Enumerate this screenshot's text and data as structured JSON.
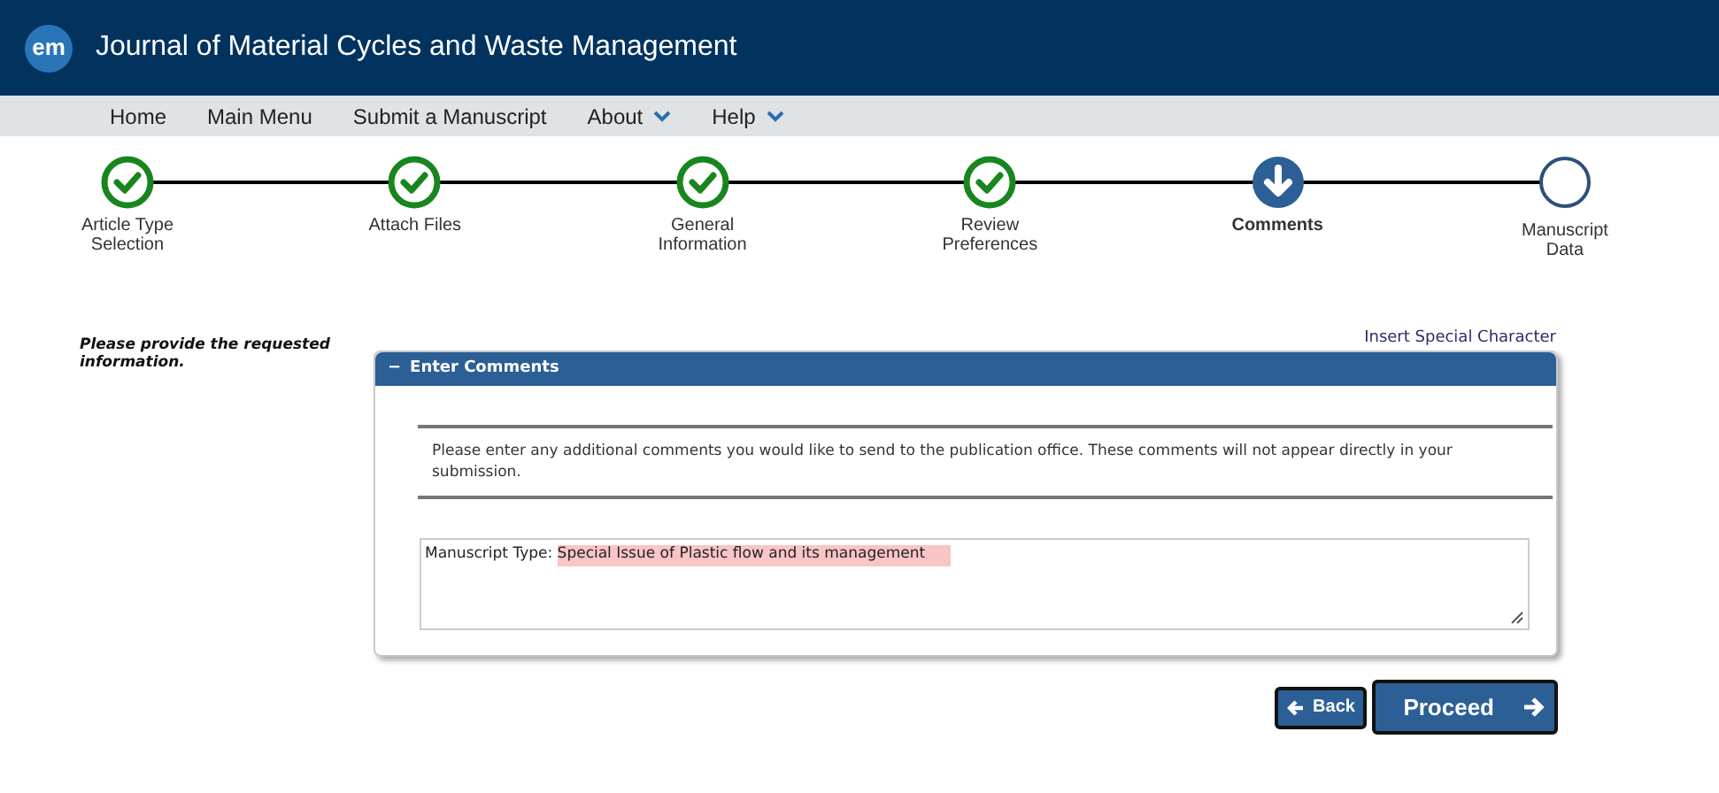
{
  "header": {
    "logo": "em",
    "title": "Journal of Material Cycles and Waste Management"
  },
  "nav": [
    {
      "label": "Home",
      "dropdown": false
    },
    {
      "label": "Main Menu",
      "dropdown": false
    },
    {
      "label": "Submit a Manuscript",
      "dropdown": false
    },
    {
      "label": "About",
      "dropdown": true
    },
    {
      "label": "Help",
      "dropdown": true
    }
  ],
  "steps": [
    {
      "label": "Article Type Selection",
      "completed": true,
      "selected": false
    },
    {
      "label": "Attach Files",
      "completed": true,
      "selected": false
    },
    {
      "label": "General Information",
      "completed": true,
      "selected": false
    },
    {
      "label": "Review Preferences",
      "completed": true,
      "selected": false
    },
    {
      "label": "Comments",
      "completed": false,
      "selected": true
    },
    {
      "label": "Manuscript Data",
      "completed": false,
      "selected": false
    }
  ],
  "instruction": "Please provide the requested information.",
  "insert_link": "Insert Special Character",
  "panel": {
    "toggle": "−",
    "title": "Enter Comments",
    "expanded": true,
    "help_text": "Please enter any additional comments you would like to send to the publication office. These comments will not appear directly in your submission.",
    "comment": {
      "prefix": "Manuscript Type:",
      "highlighted": "Special Issue of Plastic flow and its management"
    }
  },
  "buttons": {
    "back": "Back",
    "proceed": "Proceed"
  }
}
